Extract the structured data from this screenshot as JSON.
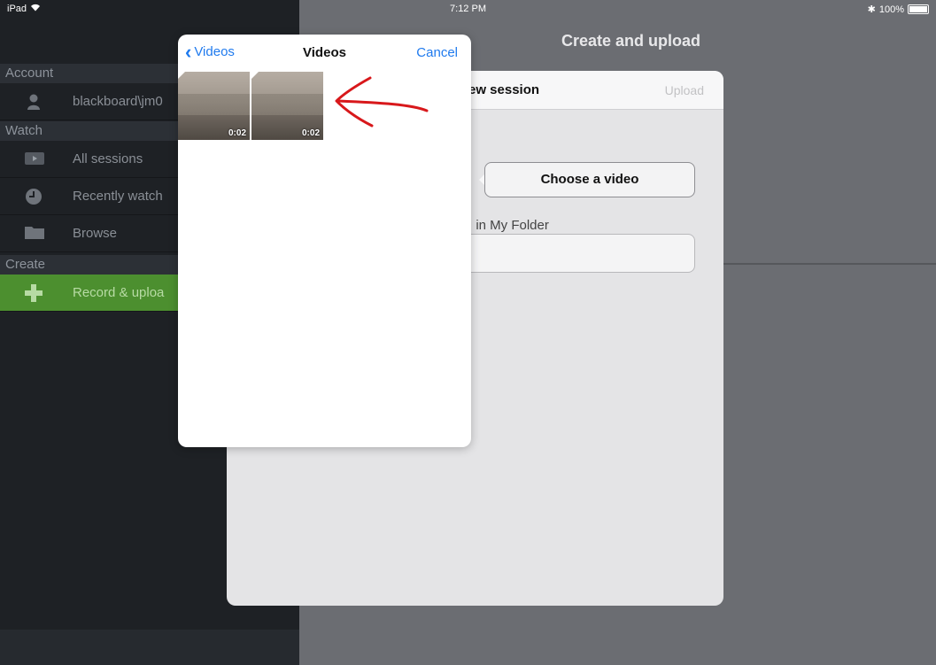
{
  "status_bar": {
    "device": "iPad",
    "time": "7:12 PM",
    "battery": "100%"
  },
  "sidebar": {
    "sections": [
      {
        "title": "Account",
        "items": [
          {
            "label": "blackboard\\jm0",
            "icon": "user-icon"
          }
        ]
      },
      {
        "title": "Watch",
        "items": [
          {
            "label": "All sessions",
            "icon": "play-icon"
          },
          {
            "label": "Recently watch",
            "icon": "clock-icon"
          },
          {
            "label": "Browse",
            "icon": "folder-icon"
          }
        ]
      },
      {
        "title": "Create",
        "items": [
          {
            "label": "Record & uploa",
            "icon": "plus-icon",
            "active": true
          }
        ]
      }
    ]
  },
  "main": {
    "nav_title": "Create and upload",
    "card": {
      "title": "ew session",
      "upload_label": "Upload",
      "choose_video_label": "Choose a video",
      "folder_label": "ı in My Folder",
      "folder_value": ""
    }
  },
  "picker": {
    "back_label": "Videos",
    "title": "Videos",
    "cancel_label": "Cancel",
    "thumbnails": [
      {
        "duration": "0:02"
      },
      {
        "duration": "0:02"
      }
    ]
  },
  "colors": {
    "accent_blue": "#1f7aee",
    "active_green": "#4c8f2f",
    "annotation_red": "#d8181b"
  }
}
